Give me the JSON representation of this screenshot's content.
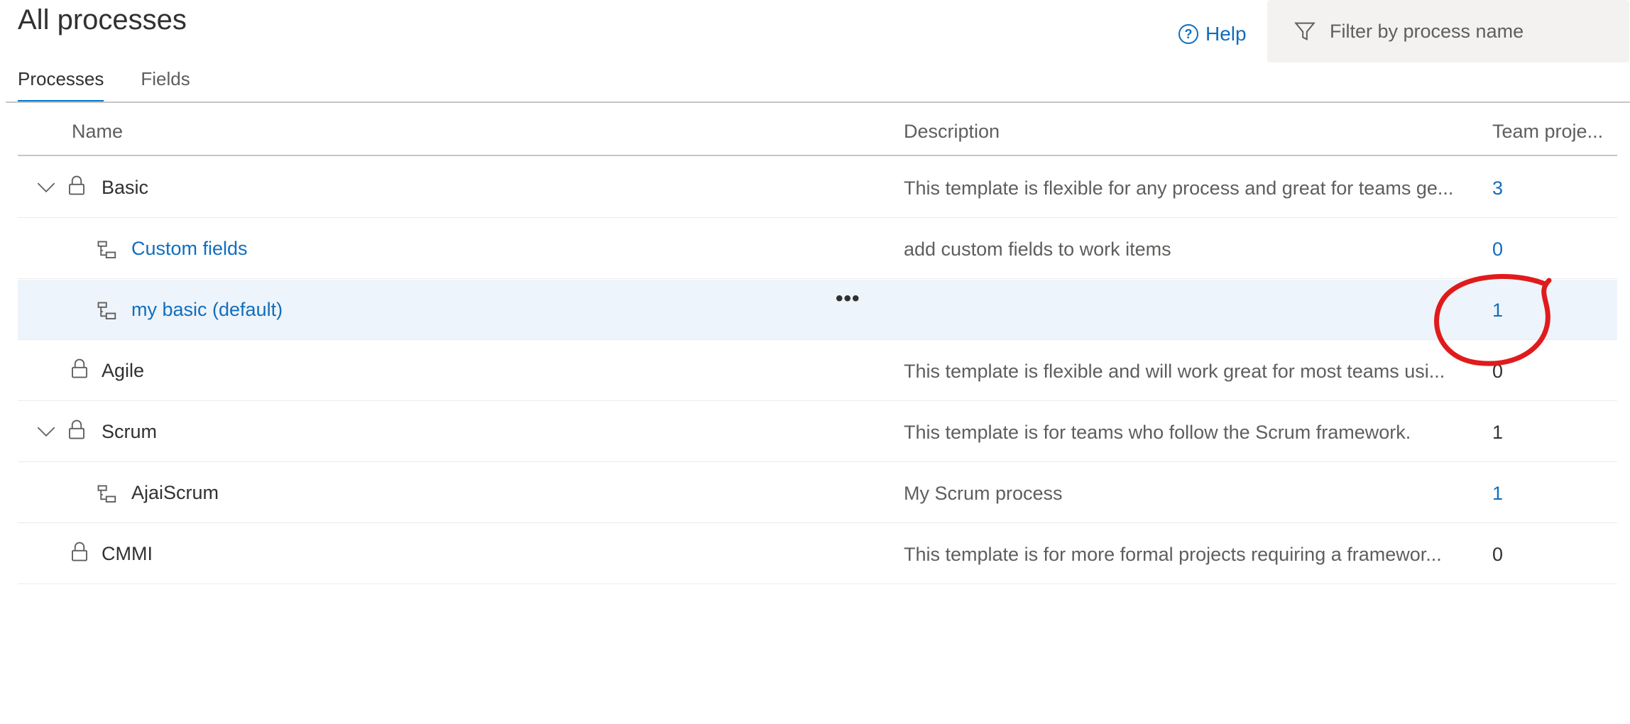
{
  "header": {
    "title": "All processes",
    "help_label": "Help",
    "filter_placeholder": "Filter by process name"
  },
  "tabs": [
    {
      "label": "Processes",
      "active": true
    },
    {
      "label": "Fields",
      "active": false
    }
  ],
  "columns": {
    "name": "Name",
    "description": "Description",
    "team_projects": "Team proje..."
  },
  "rows": [
    {
      "name": "Basic",
      "description": "This template is flexible for any process and great for teams ge...",
      "count": "3",
      "icon": "lock-icon",
      "expanded": true
    },
    {
      "name": "Custom fields",
      "description": "add custom fields to work items",
      "count": "0",
      "icon": "inherited-process-icon"
    },
    {
      "name": "my basic (default)",
      "description": "",
      "count": "1",
      "icon": "inherited-process-icon",
      "selected": true
    },
    {
      "name": "Agile",
      "description": "This template is flexible and will work great for most teams usi...",
      "count": "0",
      "icon": "lock-icon"
    },
    {
      "name": "Scrum",
      "description": "This template is for teams who follow the Scrum framework.",
      "count": "1",
      "icon": "lock-icon",
      "expanded": true
    },
    {
      "name": "AjaiScrum",
      "description": "My Scrum process",
      "count": "1",
      "icon": "inherited-process-icon"
    },
    {
      "name": "CMMI",
      "description": "This template is for more formal projects requiring a framewor...",
      "count": "0",
      "icon": "lock-icon"
    }
  ],
  "more_actions_label": "•••",
  "colors": {
    "accent": "#0078d4",
    "link": "#106ebe",
    "selected_row": "#eef4fb",
    "annotation": "#e01b1b"
  }
}
